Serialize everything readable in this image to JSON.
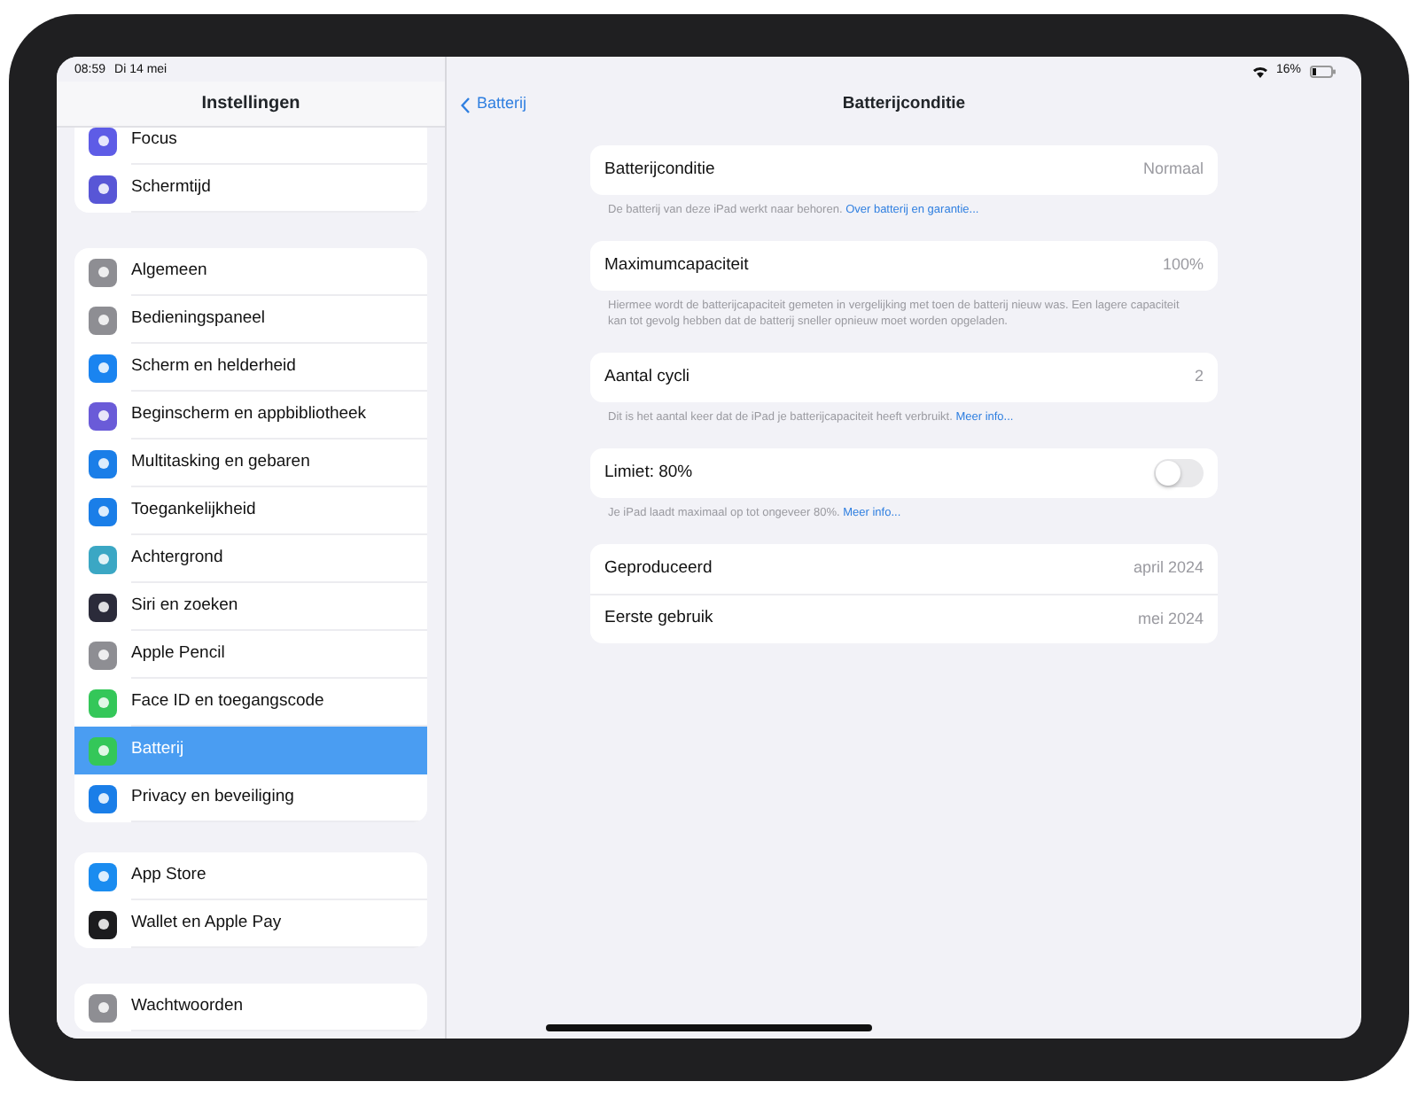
{
  "status_bar": {
    "time": "08:59",
    "date": "Di 14 mei",
    "battery": "16%"
  },
  "sidebar": {
    "title": "Instellingen",
    "groups": [
      {
        "items": [
          {
            "label": "Focus",
            "color": "#5e5ce6",
            "selected": false
          },
          {
            "label": "Schermtijd",
            "color": "#5856d6",
            "selected": false
          }
        ]
      },
      {
        "items": [
          {
            "label": "Algemeen",
            "color": "#8e8e93",
            "selected": false
          },
          {
            "label": "Bedieningspaneel",
            "color": "#8e8e93",
            "selected": false
          },
          {
            "label": "Scherm en helderheid",
            "color": "#1a84f0",
            "selected": false
          },
          {
            "label": "Beginscherm en appbibliotheek",
            "color": "#6a5bd8",
            "selected": false
          },
          {
            "label": "Multitasking en gebaren",
            "color": "#1a7ee8",
            "selected": false
          },
          {
            "label": "Toegankelijkheid",
            "color": "#1a7ee8",
            "selected": false
          },
          {
            "label": "Achtergrond",
            "color": "#3ba7c4",
            "selected": false
          },
          {
            "label": "Siri en zoeken",
            "color": "#2b2b3a",
            "selected": false
          },
          {
            "label": "Apple Pencil",
            "color": "#8e8e93",
            "selected": false
          },
          {
            "label": "Face ID en toegangscode",
            "color": "#34c759",
            "selected": false
          },
          {
            "label": "Batterij",
            "color": "#34c759",
            "selected": true
          },
          {
            "label": "Privacy en beveiliging",
            "color": "#1a7ee8",
            "selected": false
          }
        ]
      },
      {
        "items": [
          {
            "label": "App Store",
            "color": "#1a8cf0",
            "selected": false
          },
          {
            "label": "Wallet en Apple Pay",
            "color": "#1c1c1e",
            "selected": false
          }
        ]
      },
      {
        "items": [
          {
            "label": "Wachtwoorden",
            "color": "#8e8e93",
            "selected": false
          }
        ]
      }
    ]
  },
  "nav": {
    "back": "Batterij",
    "title": "Batterijconditie"
  },
  "sections": [
    {
      "rows": [
        {
          "label": "Batterijconditie",
          "value": "Normaal"
        }
      ],
      "note": "De batterij van deze iPad werkt naar behoren.",
      "link": "Over batterij en garantie..."
    },
    {
      "rows": [
        {
          "label": "Maximumcapaciteit",
          "value": "100%"
        }
      ],
      "note": "Hiermee wordt de batterijcapaciteit gemeten in vergelijking met toen de batterij nieuw was. Een lagere capaciteit kan tot gevolg hebben dat de batterij sneller opnieuw moet worden opgeladen."
    },
    {
      "rows": [
        {
          "label": "Aantal cycli",
          "value": "2"
        }
      ],
      "note": "Dit is het aantal keer dat de iPad je batterijcapaciteit heeft verbruikt.",
      "link": "Meer info..."
    },
    {
      "rows": [
        {
          "label": "Limiet: 80%",
          "kind": "toggle",
          "on": false
        }
      ],
      "note": "Je iPad laadt maximaal op tot ongeveer 80%.",
      "link": "Meer info..."
    },
    {
      "rows": [
        {
          "label": "Geproduceerd",
          "value": "april 2024"
        },
        {
          "label": "Eerste gebruik",
          "value": "mei 2024"
        }
      ]
    }
  ]
}
